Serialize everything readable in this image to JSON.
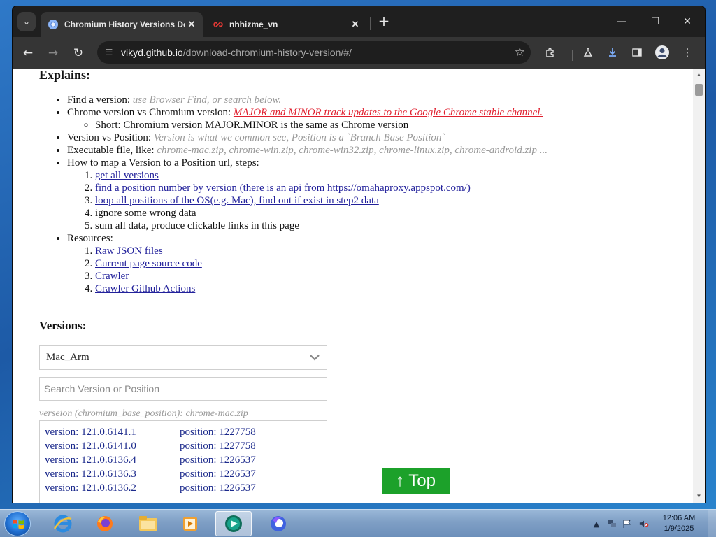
{
  "browser": {
    "tabs": [
      {
        "title": "Chromium History Versions Do",
        "active": true
      },
      {
        "title": "nhhizme_vn",
        "active": false
      }
    ],
    "url": {
      "host": "vikyd.github.io",
      "path": "/download-chromium-history-version/#/"
    }
  },
  "page": {
    "explains_heading": "Explains:",
    "items": {
      "find_label": "Find a version: ",
      "find_hint": "use Browser Find, or search below.",
      "chrome_vs_label": "Chrome version vs Chromium version: ",
      "chrome_vs_link": "MAJOR and MINOR track updates to the Google Chrome stable channel.",
      "short_note": "Short: Chromium version MAJOR.MINOR is the same as Chrome version",
      "version_vs_label": "Version vs Position: ",
      "version_vs_hint": "Version is what we common see, Position is a `Branch Base Position`",
      "exec_label": "Executable file, like: ",
      "exec_hint": "chrome-mac.zip, chrome-win.zip, chrome-win32.zip, chrome-linux.zip, chrome-android.zip ...",
      "howto_label": "How to map a Version to a Position url, steps:",
      "steps": [
        "get all versions",
        "find a position number by version (there is an api from https://omahaproxy.appspot.com/)",
        "loop all positions of the OS(e.g. Mac), find out if exist in step2 data",
        "ignore some wrong data",
        "sum all data, produce clickable links in this page"
      ],
      "resources_label": "Resources:",
      "resources": [
        "Raw JSON files",
        "Current page source code",
        "Crawler",
        "Crawler Github Actions"
      ]
    },
    "versions_heading": "Versions:",
    "os_select_value": "Mac_Arm",
    "search_placeholder": "Search Version or Position",
    "list_caption": "verseion (chromium_base_position): chrome-mac.zip",
    "versions": [
      {
        "version": "version: 121.0.6141.1",
        "position": "position: 1227758"
      },
      {
        "version": "version: 121.0.6141.0",
        "position": "position: 1227758"
      },
      {
        "version": "version: 121.0.6136.4",
        "position": "position: 1226537"
      },
      {
        "version": "version: 121.0.6136.3",
        "position": "position: 1226537"
      },
      {
        "version": "version: 121.0.6136.2",
        "position": "position: 1226537"
      }
    ],
    "top_button": "↑ Top"
  },
  "taskbar": {
    "clock_time": "12:06 AM",
    "clock_date": "1/9/2025"
  },
  "colors": {
    "accent_green": "#1ca12a",
    "link_blue": "#22219b",
    "link_red": "#e0202f"
  }
}
